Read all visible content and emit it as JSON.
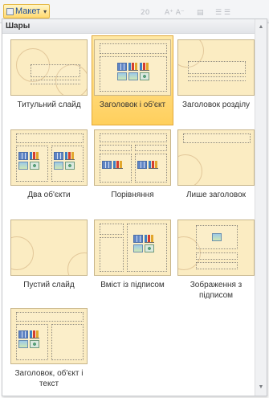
{
  "toolbar": {
    "layout_label": "Макет",
    "font_size": "20",
    "dropdown_arrow": "▾"
  },
  "panel": {
    "header": "Шары"
  },
  "tiles": [
    {
      "label": "Титульний слайд"
    },
    {
      "label": "Заголовок і об'єкт"
    },
    {
      "label": "Заголовок розділу"
    },
    {
      "label": "Два об'єкти"
    },
    {
      "label": "Порівняння"
    },
    {
      "label": "Лише заголовок"
    },
    {
      "label": "Пустий слайд"
    },
    {
      "label": "Вміст із підписом"
    },
    {
      "label": "Зображення з підписом"
    },
    {
      "label": "Заголовок, об'єкт і текст"
    }
  ],
  "selected_tile_index": 1
}
